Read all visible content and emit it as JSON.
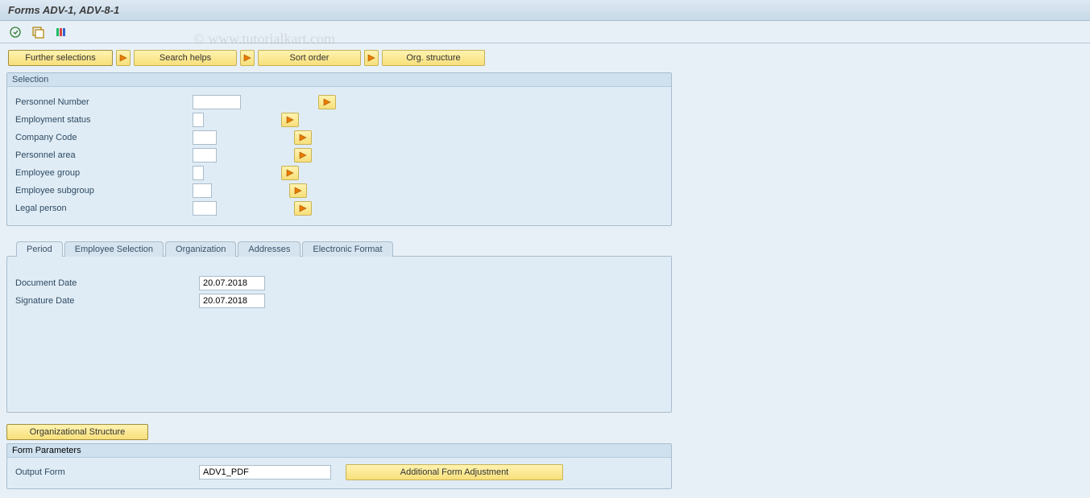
{
  "title": "Forms ADV-1, ADV-8-1",
  "watermark": "© www.tutorialkart.com",
  "nav_buttons": {
    "further_selections": "Further selections",
    "search_helps": "Search helps",
    "sort_order": "Sort order",
    "org_structure": "Org. structure"
  },
  "selection": {
    "title": "Selection",
    "fields": [
      {
        "label": "Personnel Number",
        "input_width": "w60",
        "value": ""
      },
      {
        "label": "Employment status",
        "input_width": "w12",
        "value": ""
      },
      {
        "label": "Company Code",
        "input_width": "w30",
        "value": ""
      },
      {
        "label": "Personnel area",
        "input_width": "w30",
        "value": ""
      },
      {
        "label": "Employee group",
        "input_width": "w12",
        "value": ""
      },
      {
        "label": "Employee subgroup",
        "input_width": "w24",
        "value": ""
      },
      {
        "label": "Legal person",
        "input_width": "w30",
        "value": ""
      }
    ]
  },
  "tabs": {
    "items": [
      {
        "label": "Period",
        "active": true
      },
      {
        "label": "Employee Selection",
        "active": false
      },
      {
        "label": "Organization",
        "active": false
      },
      {
        "label": "Addresses",
        "active": false
      },
      {
        "label": "Electronic Format",
        "active": false
      }
    ]
  },
  "period": {
    "document_date_label": "Document Date",
    "document_date": "20.07.2018",
    "signature_date_label": "Signature Date",
    "signature_date": "20.07.2018"
  },
  "org_structure_btn": "Organizational Structure",
  "form_parameters": {
    "title": "Form Parameters",
    "output_form_label": "Output Form",
    "output_form": "ADV1_PDF",
    "additional_adjustment": "Additional Form Adjustment"
  }
}
